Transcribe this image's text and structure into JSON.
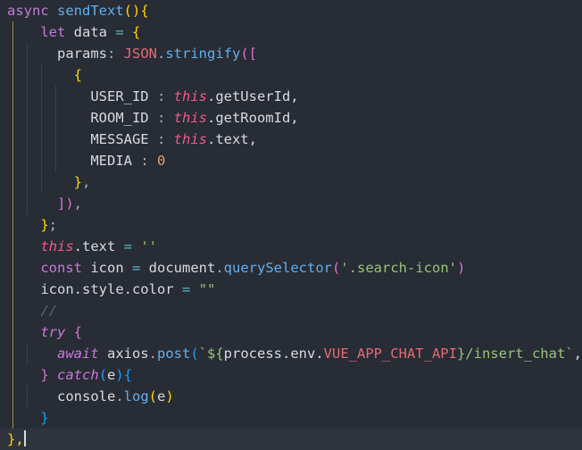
{
  "editor": {
    "lines": [
      [
        {
          "t": "async ",
          "c": "kw"
        },
        {
          "t": "sendText",
          "c": "fn"
        },
        {
          "t": "(){",
          "c": "b1"
        }
      ],
      [
        {
          "t": "    let ",
          "c": "kw"
        },
        {
          "t": "data ",
          "c": "var"
        },
        {
          "t": "= ",
          "c": "op"
        },
        {
          "t": "{",
          "c": "b1"
        }
      ],
      [
        {
          "t": "      params",
          "c": "var"
        },
        {
          "t": ": ",
          "c": "punc"
        },
        {
          "t": "JSON",
          "c": "prop"
        },
        {
          "t": ".",
          "c": "punc"
        },
        {
          "t": "stringify",
          "c": "fn"
        },
        {
          "t": "([",
          "c": "b2"
        }
      ],
      [
        {
          "t": "        ",
          "c": "var"
        },
        {
          "t": "{",
          "c": "b1"
        }
      ],
      [
        {
          "t": "          USER_ID ",
          "c": "var"
        },
        {
          "t": ": ",
          "c": "punc"
        },
        {
          "t": "this",
          "c": "this2"
        },
        {
          "t": ".getUserId,",
          "c": "var"
        }
      ],
      [
        {
          "t": "          ROOM_ID ",
          "c": "var"
        },
        {
          "t": ": ",
          "c": "punc"
        },
        {
          "t": "this",
          "c": "this2"
        },
        {
          "t": ".getRoomId,",
          "c": "var"
        }
      ],
      [
        {
          "t": "          MESSAGE ",
          "c": "var"
        },
        {
          "t": ": ",
          "c": "punc"
        },
        {
          "t": "this",
          "c": "this2"
        },
        {
          "t": ".text,",
          "c": "var"
        }
      ],
      [
        {
          "t": "          MEDIA ",
          "c": "var"
        },
        {
          "t": ": ",
          "c": "punc"
        },
        {
          "t": "0",
          "c": "num"
        }
      ],
      [
        {
          "t": "        ",
          "c": "var"
        },
        {
          "t": "}",
          "c": "b1"
        },
        {
          "t": ",",
          "c": "punc"
        }
      ],
      [
        {
          "t": "      ",
          "c": "var"
        },
        {
          "t": "])",
          "c": "b2"
        },
        {
          "t": ",",
          "c": "punc"
        }
      ],
      [
        {
          "t": "    ",
          "c": "var"
        },
        {
          "t": "}",
          "c": "b1"
        },
        {
          "t": ";",
          "c": "punc"
        }
      ],
      [
        {
          "t": "    ",
          "c": "var"
        },
        {
          "t": "this",
          "c": "this2"
        },
        {
          "t": ".text ",
          "c": "var"
        },
        {
          "t": "= ",
          "c": "op"
        },
        {
          "t": "''",
          "c": "str"
        }
      ],
      [
        {
          "t": "    const ",
          "c": "kw"
        },
        {
          "t": "icon ",
          "c": "var"
        },
        {
          "t": "= ",
          "c": "op"
        },
        {
          "t": "document",
          "c": "var"
        },
        {
          "t": ".",
          "c": "punc"
        },
        {
          "t": "querySelector",
          "c": "fn"
        },
        {
          "t": "(",
          "c": "b2"
        },
        {
          "t": "'.search-icon'",
          "c": "str"
        },
        {
          "t": ")",
          "c": "b2"
        }
      ],
      [
        {
          "t": "    icon.style.color ",
          "c": "var"
        },
        {
          "t": "= ",
          "c": "op"
        },
        {
          "t": "\"\"",
          "c": "str"
        }
      ],
      [
        {
          "t": "    //",
          "c": "cmt"
        }
      ],
      [
        {
          "t": "    ",
          "c": "var"
        },
        {
          "t": "try",
          "c": "inctl"
        },
        {
          "t": " ",
          "c": "var"
        },
        {
          "t": "{",
          "c": "b2"
        }
      ],
      [
        {
          "t": "      await ",
          "c": "inctl"
        },
        {
          "t": "axios",
          "c": "var"
        },
        {
          "t": ".",
          "c": "punc"
        },
        {
          "t": "post",
          "c": "fn"
        },
        {
          "t": "(",
          "c": "b3"
        },
        {
          "t": "`${",
          "c": "str"
        },
        {
          "t": "process.env.",
          "c": "var"
        },
        {
          "t": "VUE_APP_CHAT_API",
          "c": "tmpl"
        },
        {
          "t": "}/insert_chat`",
          "c": "str"
        },
        {
          "t": ",data",
          "c": "var"
        },
        {
          "t": ")",
          "c": "b3"
        }
      ],
      [
        {
          "t": "    ",
          "c": "var"
        },
        {
          "t": "}",
          "c": "b2"
        },
        {
          "t": " ",
          "c": "var"
        },
        {
          "t": "catch",
          "c": "inctl"
        },
        {
          "t": "(",
          "c": "b3"
        },
        {
          "t": "e",
          "c": "var"
        },
        {
          "t": ")",
          "c": "b3"
        },
        {
          "t": "{",
          "c": "b3"
        }
      ],
      [
        {
          "t": "      console",
          "c": "var"
        },
        {
          "t": ".",
          "c": "punc"
        },
        {
          "t": "log",
          "c": "fn"
        },
        {
          "t": "(",
          "c": "b1"
        },
        {
          "t": "e",
          "c": "var"
        },
        {
          "t": ")",
          "c": "b1"
        }
      ],
      [
        {
          "t": "    ",
          "c": "var"
        },
        {
          "t": "}",
          "c": "b3"
        }
      ],
      [
        {
          "t": "},",
          "c": "b1"
        }
      ]
    ],
    "cursor_line_index": 20
  }
}
